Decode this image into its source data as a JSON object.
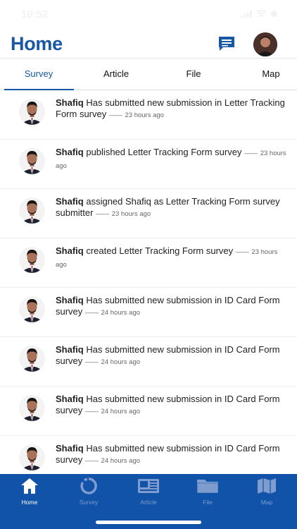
{
  "status_bar": {
    "time": "10:52"
  },
  "header": {
    "title": "Home",
    "chat_icon": "chat-icon",
    "avatar": "user-avatar"
  },
  "tabs": [
    {
      "label": "Survey",
      "active": true
    },
    {
      "label": "Article",
      "active": false
    },
    {
      "label": "File",
      "active": false
    },
    {
      "label": "Map",
      "active": false
    }
  ],
  "feed": [
    {
      "user": "Shafiq",
      "action": " Has submitted new submission in Letter Tracking Form survey",
      "time": "23 hours ago"
    },
    {
      "user": "Shafiq",
      "action": " published Letter Tracking Form survey",
      "time": "23 hours ago"
    },
    {
      "user": "Shafiq",
      "action": " assigned Shafiq as Letter Tracking Form survey submitter",
      "time": "23 hours ago"
    },
    {
      "user": "Shafiq",
      "action": " created Letter Tracking Form survey",
      "time": "23 hours ago"
    },
    {
      "user": "Shafiq",
      "action": " Has submitted new submission in ID Card Form survey",
      "time": "24 hours ago"
    },
    {
      "user": "Shafiq",
      "action": " Has submitted new submission in ID Card Form survey",
      "time": "24 hours ago"
    },
    {
      "user": "Shafiq",
      "action": " Has submitted new submission in ID Card Form survey",
      "time": "24 hours ago"
    },
    {
      "user": "Shafiq",
      "action": " Has submitted new submission in ID Card Form survey",
      "time": "24 hours ago"
    }
  ],
  "bottom_nav": [
    {
      "label": "Home",
      "icon": "home-icon",
      "active": true
    },
    {
      "label": "Survey",
      "icon": "survey-icon",
      "active": false
    },
    {
      "label": "Article",
      "icon": "article-icon",
      "active": false
    },
    {
      "label": "File",
      "icon": "folder-icon",
      "active": false
    },
    {
      "label": "Map",
      "icon": "map-icon",
      "active": false
    }
  ],
  "colors": {
    "brand_blue": "#1857a6",
    "nav_background": "#1153a8",
    "nav_inactive": "#7e9ccd"
  }
}
